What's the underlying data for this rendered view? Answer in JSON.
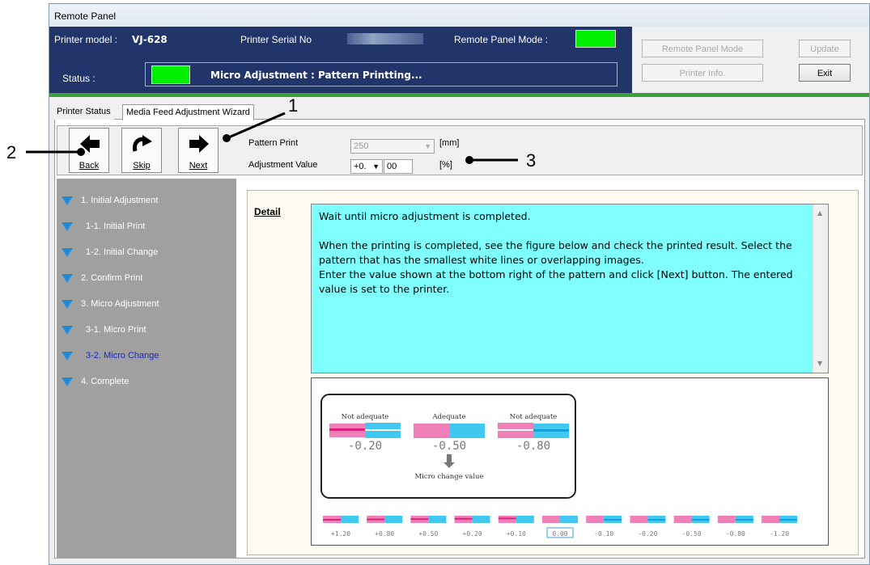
{
  "window": {
    "title": "Remote Panel"
  },
  "header": {
    "printer_model_label": "Printer model :",
    "printer_model_value": "VJ-628",
    "serial_label": "Printer Serial No",
    "mode_label": "Remote Panel Mode :",
    "status_label": "Status :",
    "status_message": "Micro Adjustment : Pattern Printting...",
    "status_color": "#00ee00"
  },
  "buttons": {
    "remote_panel_mode": "Remote Panel Mode",
    "update": "Update",
    "printer_info": "Printer Info.",
    "exit": "Exit"
  },
  "tabs": [
    "Printer Status",
    "Media Feed Adjustment Wizard"
  ],
  "toolbar": {
    "back": "Back",
    "skip": "Skip",
    "next": "Next",
    "pattern_print_label": "Pattern Print",
    "pattern_print_value": "250",
    "pattern_print_unit": "[mm]",
    "adjustment_label": "Adjustment Value",
    "adjustment_sign": "+0.",
    "adjustment_value": "00",
    "adjustment_unit": "[%]"
  },
  "steps": [
    {
      "label": "1. Initial Adjustment",
      "active": false
    },
    {
      "label": "1-1.  Initial Print",
      "active": false
    },
    {
      "label": "1-2.  Initial Change",
      "active": false
    },
    {
      "label": "2.  Confirm Print",
      "active": false
    },
    {
      "label": "3. Micro Adjustment",
      "active": false
    },
    {
      "label": "3-1.  Micro Print",
      "active": false
    },
    {
      "label": "3-2.  Micro Change",
      "active": true
    },
    {
      "label": "4. Complete",
      "active": false
    }
  ],
  "detail": {
    "label": "Detail",
    "line1": "Wait until micro adjustment is completed.",
    "line2": "When the printing is completed, see the figure below and check the printed result. Select the pattern that has the smallest white lines or overlapping images.",
    "line3": "Enter the value shown at the bottom right of the pattern and click [Next] button. The entered value is set to the printer."
  },
  "figure": {
    "examples": [
      {
        "caption": "Not adequate",
        "value": "-0.20"
      },
      {
        "caption": "Adequate",
        "value": "-0.50"
      },
      {
        "caption": "Not adequate",
        "value": "-0.80"
      }
    ],
    "micro_change_label": "Micro change value",
    "patterns": [
      "+1.20",
      "+0.80",
      "+0.50",
      "+0.20",
      "+0.10",
      "0.00",
      "-0.10",
      "-0.20",
      "-0.50",
      "-0.80",
      "-1.20"
    ],
    "selected_pattern": "0.00",
    "magenta": "#f080b8",
    "cyan": "#40c8f0"
  },
  "annotations": [
    "1",
    "2",
    "3"
  ],
  "icons": {
    "back": "arrow-left-icon",
    "skip": "rotate-right-icon",
    "next": "arrow-right-icon",
    "step": "triangle-down-icon"
  }
}
